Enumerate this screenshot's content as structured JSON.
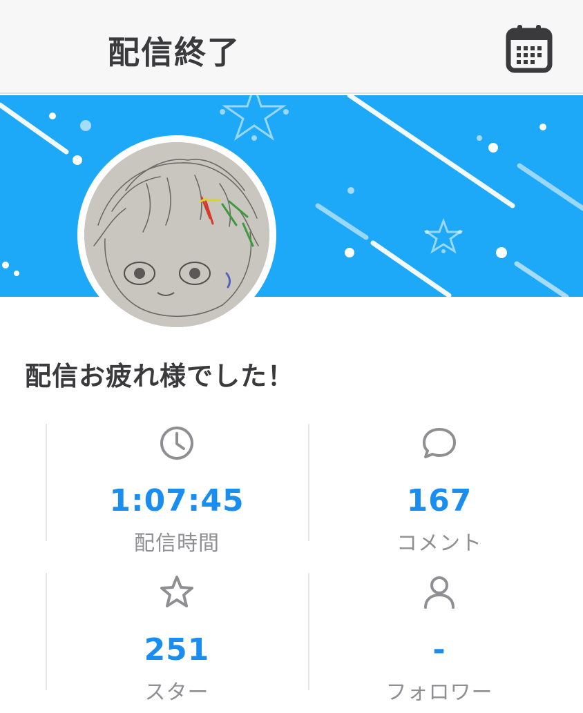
{
  "header": {
    "title": "配信終了",
    "calendar_icon": "calendar-icon"
  },
  "banner": {
    "background_color": "#1ea8f8"
  },
  "avatar": {
    "description_icon": "avatar"
  },
  "message": "配信お疲れ様でした！",
  "stats": [
    {
      "icon": "clock-icon",
      "value": "1:07:45",
      "label": "配信時間"
    },
    {
      "icon": "comment-icon",
      "value": "167",
      "label": "コメント"
    },
    {
      "icon": "star-icon",
      "value": "251",
      "label": "スター"
    },
    {
      "icon": "person-icon",
      "value": "-",
      "label": "フォロワー"
    }
  ],
  "colors": {
    "accent": "#1a8df0",
    "label": "#8e8e93",
    "text": "#3a3a3c"
  }
}
